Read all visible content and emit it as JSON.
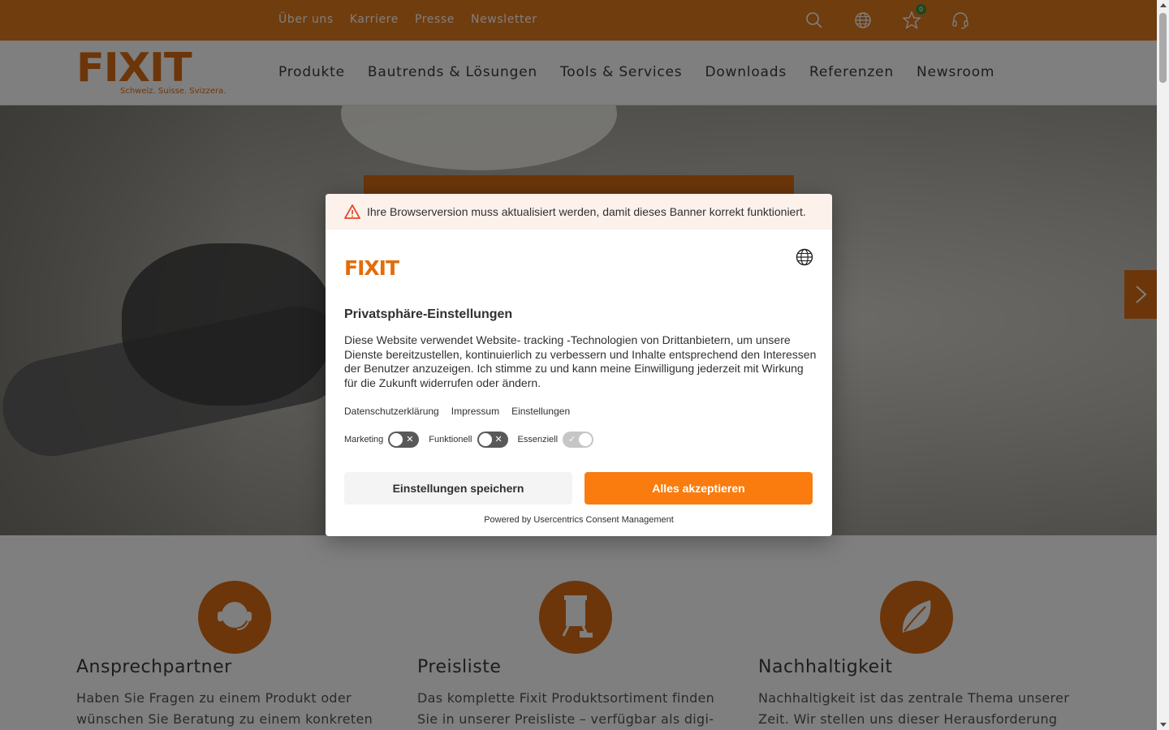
{
  "topbar": {
    "links": [
      "Über uns",
      "Karriere",
      "Presse",
      "Newsletter"
    ],
    "icons": [
      "search-icon",
      "globe-icon",
      "star-icon",
      "headset-icon"
    ],
    "favorites_count": "0"
  },
  "logo": {
    "word": "FIXIT",
    "tagline": "Schweiz. Suisse. Svizzera."
  },
  "mainnav": {
    "items": [
      "Produkte",
      "Bautrends & Lösungen",
      "Tools & Services",
      "Downloads",
      "Referenzen",
      "Newsroom"
    ]
  },
  "features": [
    {
      "title": "Ansprechpartner",
      "text": "Haben Sie Fragen zu einem Produkt oder wünschen Sie Beratung zu einem konkreten",
      "icon": "headset-person-icon"
    },
    {
      "title": "Preisliste",
      "text": "Das komplette Fixit Produktsortiment finden Sie in unserer Preisliste – verfügbar als digi-",
      "icon": "silo-icon"
    },
    {
      "title": "Nachhaltigkeit",
      "text": "Nachhaltigkeit ist das zentrale Thema unserer Zeit. Wir stellen uns dieser Herausforderung",
      "icon": "leaf-icon"
    }
  ],
  "consent": {
    "warning": "Ihre Browserversion muss aktualisiert werden, damit dieses Banner korrekt funktioniert.",
    "logo_word": "FIXIT",
    "title": "Privatsphäre-Einstellungen",
    "body": "Diese Website verwendet Website- tracking -Technologien von Drittanbietern, um unsere Dienste bereitzustellen, kontinuierlich zu verbessern und Inhalte entsprechend den Interessen der Benutzer anzuzeigen. Ich stimme zu und kann meine Einwilligung jederzeit mit Wirkung für die Zukunft widerrufen oder ändern.",
    "links": [
      "Datenschutzerklärung",
      "Impressum",
      "Einstellungen"
    ],
    "toggles": [
      {
        "label": "Marketing",
        "state": "off",
        "mark": "✕"
      },
      {
        "label": "Funktionell",
        "state": "off",
        "mark": "✕"
      },
      {
        "label": "Essenziell",
        "state": "on-locked",
        "mark": "✓"
      }
    ],
    "save_label": "Einstellungen speichern",
    "accept_label": "Alles akzeptieren",
    "powered_by": "Powered by Usercentrics Consent Management"
  },
  "colors": {
    "brand_orange": "#e07a1f",
    "accept_orange": "#fa7c0e",
    "toggle_off": "#595959",
    "toggle_locked": "#c6c6c6",
    "warning_bg": "#fdf1ec",
    "warning_icon": "#e04b2a"
  }
}
